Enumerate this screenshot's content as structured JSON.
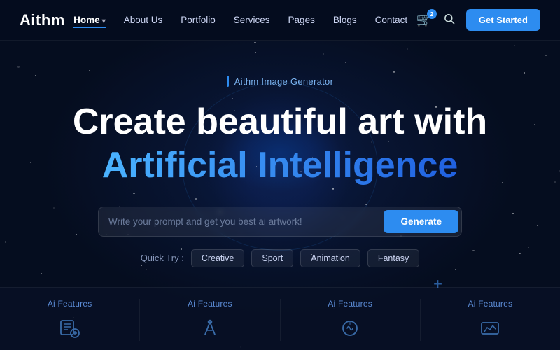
{
  "brand": {
    "name": "Aithm"
  },
  "navbar": {
    "links": [
      {
        "id": "home",
        "label": "Home",
        "has_arrow": true,
        "active": true
      },
      {
        "id": "about",
        "label": "About Us",
        "active": false
      },
      {
        "id": "portfolio",
        "label": "Portfolio",
        "active": false
      },
      {
        "id": "services",
        "label": "Services",
        "active": false
      },
      {
        "id": "pages",
        "label": "Pages",
        "active": false
      },
      {
        "id": "blogs",
        "label": "Blogs",
        "active": false
      },
      {
        "id": "contact",
        "label": "Contact",
        "active": false
      }
    ],
    "cart_count": "2",
    "cta_label": "Get Started"
  },
  "hero": {
    "badge_text": "Aithm Image Generator",
    "title_line1": "Create beautiful art with",
    "title_line2": "Artificial Intelligence",
    "search_placeholder": "Write your prompt and get you best ai artwork!",
    "generate_label": "Generate",
    "quick_try_label": "Quick Try :",
    "quick_tags": [
      "Creative",
      "Sport",
      "Animation",
      "Fantasy"
    ]
  },
  "features": [
    {
      "id": "feat1",
      "label": "Ai Features"
    },
    {
      "id": "feat2",
      "label": "Ai Features"
    },
    {
      "id": "feat3",
      "label": "Ai Features"
    },
    {
      "id": "feat4",
      "label": "Ai Features"
    }
  ],
  "colors": {
    "accent": "#2d8cf0",
    "bg": "#050d1f"
  }
}
